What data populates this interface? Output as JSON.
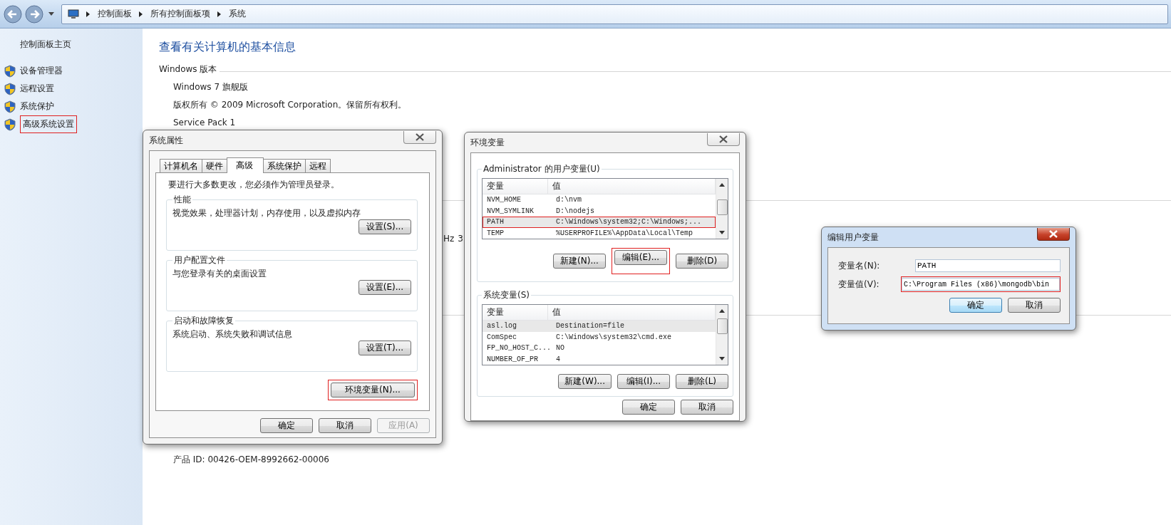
{
  "address_bar": {
    "breadcrumbs": [
      "控制面板",
      "所有控制面板项",
      "系统"
    ]
  },
  "sidebar": {
    "home": "控制面板主页",
    "items": [
      {
        "label": "设备管理器",
        "highlighted": false
      },
      {
        "label": "远程设置",
        "highlighted": false
      },
      {
        "label": "系统保护",
        "highlighted": false
      },
      {
        "label": "高级系统设置",
        "highlighted": true
      }
    ]
  },
  "main": {
    "title": "查看有关计算机的基本信息",
    "section": "Windows 版本",
    "lines": [
      "Windows 7 旗舰版",
      "版权所有 © 2009 Microsoft Corporation。保留所有权利。",
      "Service Pack 1"
    ],
    "fragments": [
      "Hz",
      "3"
    ],
    "product_id": "产品 ID: 00426-OEM-8992662-00006"
  },
  "system_properties": {
    "title": "系统属性",
    "tabs": [
      {
        "label": "计算机名",
        "selected": false
      },
      {
        "label": "硬件",
        "selected": false
      },
      {
        "label": "高级",
        "selected": true
      },
      {
        "label": "系统保护",
        "selected": false
      },
      {
        "label": "远程",
        "selected": false
      }
    ],
    "note": "要进行大多数更改，您必须作为管理员登录。",
    "groups": [
      {
        "title": "性能",
        "description": "视觉效果，处理器计划，内存使用，以及虚拟内存",
        "button": "设置(S)..."
      },
      {
        "title": "用户配置文件",
        "description": "与您登录有关的桌面设置",
        "button": "设置(E)..."
      },
      {
        "title": "启动和故障恢复",
        "description": "系统启动、系统失败和调试信息",
        "button": "设置(T)..."
      }
    ],
    "env_button": {
      "label": "环境变量(N)...",
      "highlighted": true
    },
    "buttons": [
      {
        "label": "确定",
        "disabled": false
      },
      {
        "label": "取消",
        "disabled": false
      },
      {
        "label": "应用(A)",
        "disabled": true
      }
    ]
  },
  "environment_variables": {
    "title": "环境变量",
    "sections": [
      {
        "title": "Administrator 的用户变量(U)",
        "columns": [
          "变量",
          "值"
        ],
        "rows": [
          {
            "name": "NVM_HOME",
            "value": "d:\\nvm",
            "selected": false,
            "highlighted": false
          },
          {
            "name": "NVM_SYMLINK",
            "value": "D:\\nodejs",
            "selected": false,
            "highlighted": false
          },
          {
            "name": "PATH",
            "value": "C:\\Windows\\system32;C:\\Windows;...",
            "selected": true,
            "highlighted": true
          },
          {
            "name": "TEMP",
            "value": "%USERPROFILE%\\AppData\\Local\\Temp",
            "selected": false,
            "highlighted": false
          }
        ],
        "buttons": [
          {
            "label": "新建(N)...",
            "highlighted": false
          },
          {
            "label": "编辑(E)...",
            "highlighted": true
          },
          {
            "label": "删除(D)",
            "highlighted": false
          }
        ]
      },
      {
        "title": "系统变量(S)",
        "columns": [
          "变量",
          "值"
        ],
        "rows": [
          {
            "name": "asl.log",
            "value": "Destination=file",
            "selected": true,
            "highlighted": false
          },
          {
            "name": "ComSpec",
            "value": "C:\\Windows\\system32\\cmd.exe",
            "selected": false,
            "highlighted": false
          },
          {
            "name": "FP_NO_HOST_C...",
            "value": "NO",
            "selected": false,
            "highlighted": false
          },
          {
            "name": "NUMBER_OF_PR",
            "value": "4",
            "selected": false,
            "highlighted": false
          }
        ],
        "buttons": [
          {
            "label": "新建(W)...",
            "highlighted": false
          },
          {
            "label": "编辑(I)...",
            "highlighted": false
          },
          {
            "label": "删除(L)",
            "highlighted": false
          }
        ]
      }
    ],
    "buttons": [
      "确定",
      "取消"
    ]
  },
  "edit_dialog": {
    "title": "编辑用户变量",
    "fields": [
      {
        "label": "变量名(N):",
        "value": "PATH",
        "highlighted": false
      },
      {
        "label": "变量值(V):",
        "value": "C:\\Program Files (x86)\\mongodb\\bin",
        "highlighted": true
      }
    ],
    "buttons": [
      {
        "label": "确定",
        "default": true
      },
      {
        "label": "取消",
        "default": false
      }
    ]
  }
}
